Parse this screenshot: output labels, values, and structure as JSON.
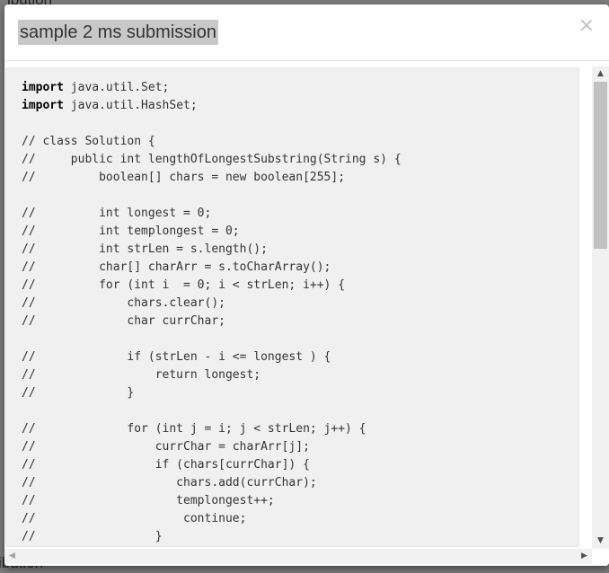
{
  "background": {
    "top_text": "ibution",
    "bottom_text": "ibution"
  },
  "modal": {
    "title": "sample 2 ms submission",
    "close_glyph": "×"
  },
  "code_lines": [
    {
      "kw": "import",
      "rest": " java.util.Set;"
    },
    {
      "kw": "import",
      "rest": " java.util.HashSet;"
    },
    {
      "kw": "",
      "rest": ""
    },
    {
      "kw": "",
      "rest": "// class Solution {"
    },
    {
      "kw": "",
      "rest": "//     public int lengthOfLongestSubstring(String s) {"
    },
    {
      "kw": "",
      "rest": "//         boolean[] chars = new boolean[255];"
    },
    {
      "kw": "",
      "rest": ""
    },
    {
      "kw": "",
      "rest": "//         int longest = 0;"
    },
    {
      "kw": "",
      "rest": "//         int templongest = 0;"
    },
    {
      "kw": "",
      "rest": "//         int strLen = s.length();"
    },
    {
      "kw": "",
      "rest": "//         char[] charArr = s.toCharArray();"
    },
    {
      "kw": "",
      "rest": "//         for (int i  = 0; i < strLen; i++) {"
    },
    {
      "kw": "",
      "rest": "//             chars.clear();"
    },
    {
      "kw": "",
      "rest": "//             char currChar;"
    },
    {
      "kw": "",
      "rest": ""
    },
    {
      "kw": "",
      "rest": "//             if (strLen - i <= longest ) {"
    },
    {
      "kw": "",
      "rest": "//                 return longest;"
    },
    {
      "kw": "",
      "rest": "//             }"
    },
    {
      "kw": "",
      "rest": ""
    },
    {
      "kw": "",
      "rest": "//             for (int j = i; j < strLen; j++) {"
    },
    {
      "kw": "",
      "rest": "//                 currChar = charArr[j];"
    },
    {
      "kw": "",
      "rest": "//                 if (chars[currChar]) {"
    },
    {
      "kw": "",
      "rest": "//                    chars.add(currChar);"
    },
    {
      "kw": "",
      "rest": "//                    templongest++;"
    },
    {
      "kw": "",
      "rest": "//                     continue;"
    },
    {
      "kw": "",
      "rest": "//                 }"
    }
  ],
  "scrollbars": {
    "up": "▲",
    "down": "▼",
    "left": "◀",
    "right": "▶"
  }
}
